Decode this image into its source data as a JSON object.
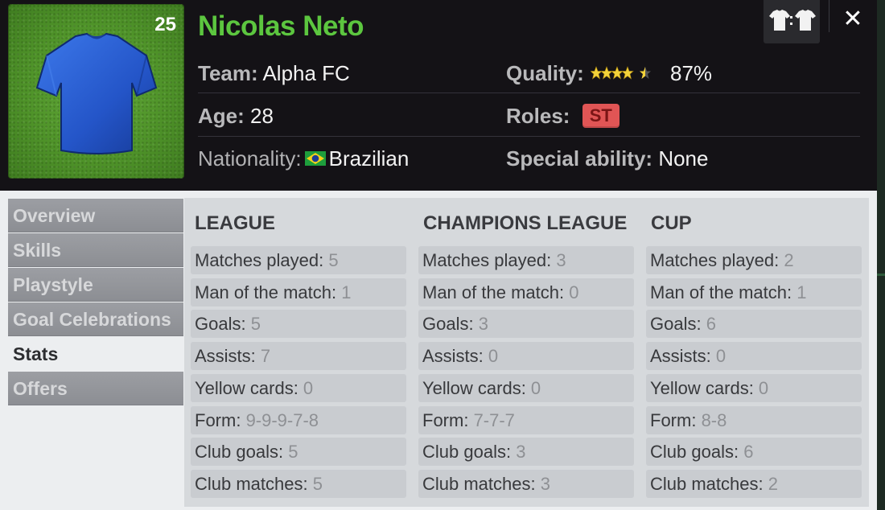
{
  "player": {
    "shirt_number": "25",
    "name": "Nicolas Neto",
    "team_label": "Team:",
    "team": "Alpha FC",
    "age_label": "Age:",
    "age": "28",
    "nationality_label": "Nationality:",
    "nationality": "Brazilian",
    "quality_label": "Quality:",
    "quality_percent": "87%",
    "quality_stars": 4.5,
    "roles_label": "Roles:",
    "role": "ST",
    "special_label": "Special ability:",
    "special": "None"
  },
  "tabs": [
    {
      "label": "Overview",
      "active": false
    },
    {
      "label": "Skills",
      "active": false
    },
    {
      "label": "Playstyle",
      "active": false
    },
    {
      "label": "Goal Celebrations",
      "active": false
    },
    {
      "label": "Stats",
      "active": true
    },
    {
      "label": "Offers",
      "active": false
    }
  ],
  "stats": {
    "row_labels": [
      "Matches played:",
      "Man of the match:",
      "Goals:",
      "Assists:",
      "Yellow cards:",
      "Form:",
      "Club goals:",
      "Club matches:"
    ],
    "columns": [
      {
        "title": "LEAGUE",
        "values": [
          "5",
          "1",
          "5",
          "7",
          "0",
          "9-9-9-7-8",
          "5",
          "5"
        ]
      },
      {
        "title": "CHAMPIONS LEAGUE",
        "values": [
          "3",
          "0",
          "3",
          "0",
          "0",
          "7-7-7",
          "3",
          "3"
        ]
      },
      {
        "title": "CUP",
        "values": [
          "2",
          "1",
          "6",
          "0",
          "0",
          "8-8",
          "6",
          "2"
        ]
      }
    ]
  },
  "icons": {
    "kits": "shirt-swap-icon",
    "close": "close-icon"
  },
  "colors": {
    "name": "#5cc63f",
    "jersey": "#2d64d8",
    "role_badge": "#e05555"
  }
}
